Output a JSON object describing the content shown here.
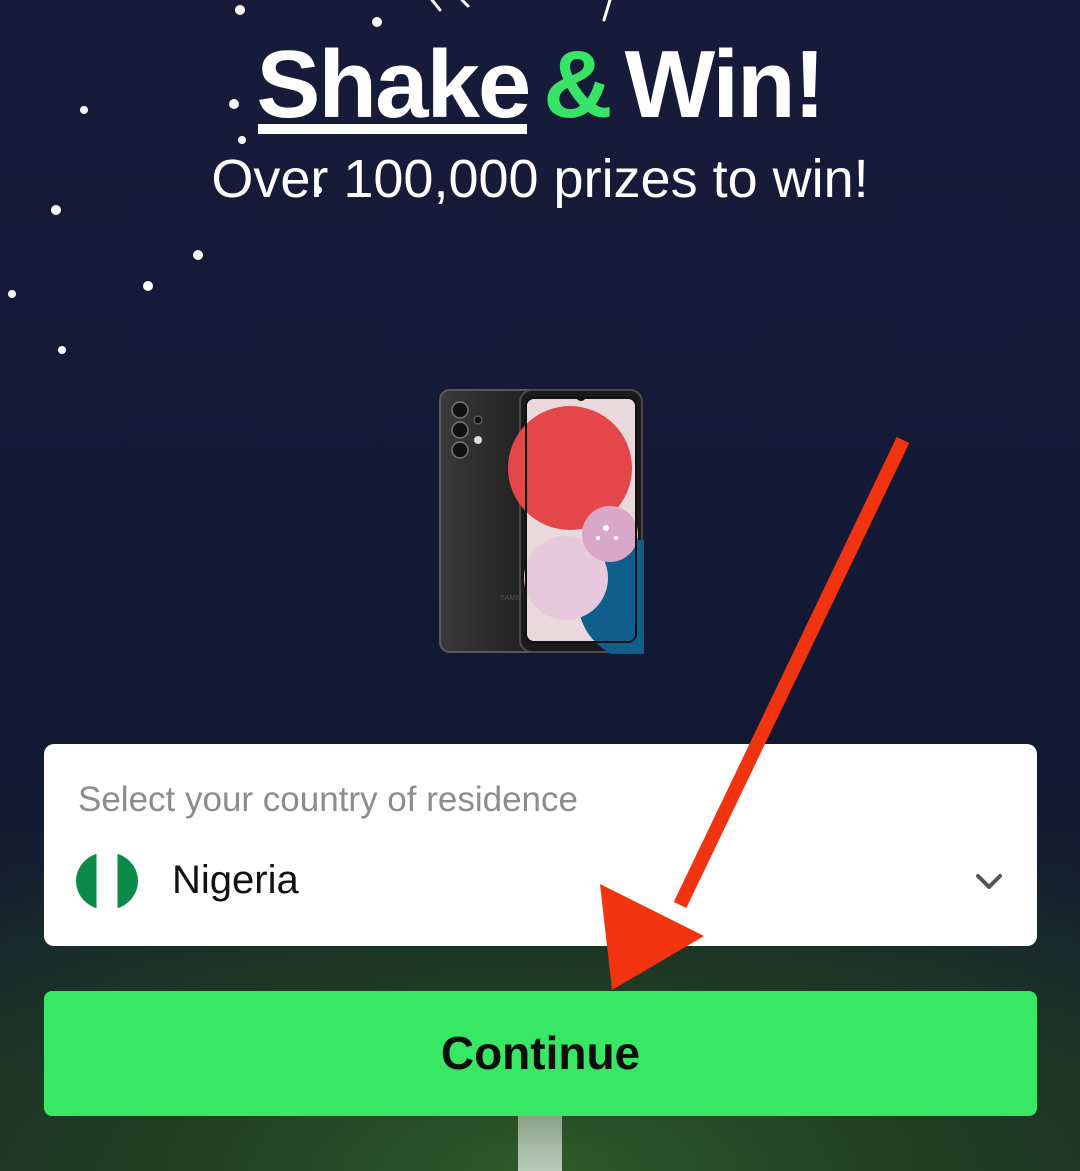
{
  "header": {
    "title_part1": "Shake",
    "title_amp": "&",
    "title_part2": "Win!",
    "subtitle": "Over 100,000 prizes to win!"
  },
  "prize": {
    "image_icon": "smartphone-prize-icon",
    "brand_mark": "SAMSUNG"
  },
  "country_select": {
    "label": "Select your country of residence",
    "selected_country": "Nigeria",
    "flag_icon": "nigeria-flag-icon",
    "dropdown_icon": "chevron-down-icon"
  },
  "actions": {
    "continue_label": "Continue"
  },
  "annotation": {
    "arrow_icon": "red-arrow-icon",
    "arrow_color": "#f2330f"
  },
  "colors": {
    "accent_green": "#38e465",
    "button_green": "#38e865",
    "background_dark": "#151a37"
  }
}
